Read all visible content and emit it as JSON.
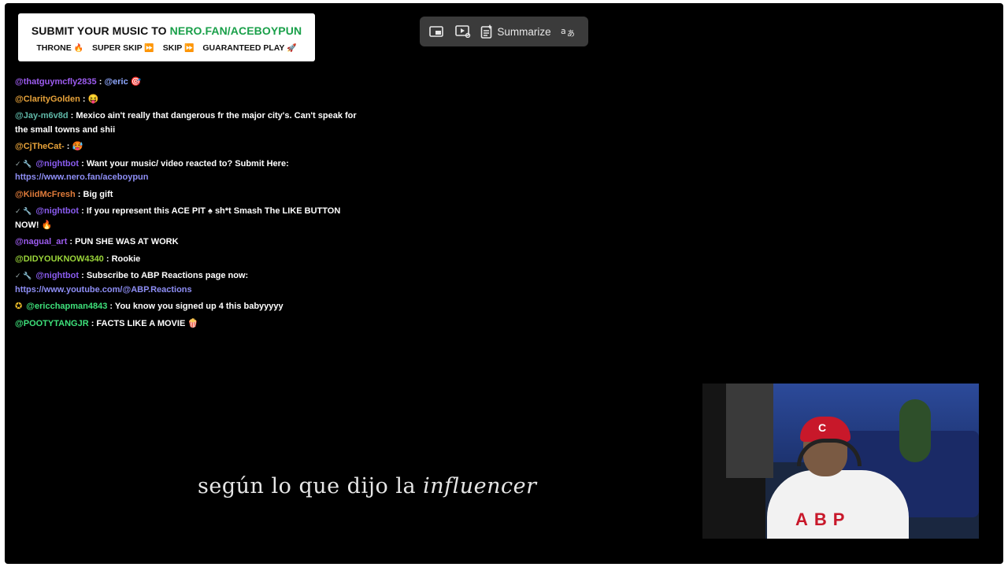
{
  "banner": {
    "line1_prefix": "SUBMIT YOUR MUSIC TO ",
    "line1_link": "NERO.FAN/ACEBOYPUN",
    "tiers": [
      {
        "label": "THRONE",
        "emoji": "🔥"
      },
      {
        "label": "SUPER SKIP",
        "emoji": "⏩"
      },
      {
        "label": "SKIP",
        "emoji": "⏩"
      },
      {
        "label": "GUARANTEED PLAY",
        "emoji": "🚀"
      }
    ]
  },
  "toolbar": {
    "summarize_label": "Summarize",
    "icons": [
      "picture-in-picture-icon",
      "video-cast-icon",
      "summarize-icon",
      "translate-icon"
    ]
  },
  "chat": {
    "messages": [
      {
        "badge": "",
        "user": "@thatguymcfly2835",
        "user_color": "#9d5cf0",
        "text": "",
        "mention": "@eric",
        "emoji": "🎯"
      },
      {
        "badge": "",
        "user": "@ClarityGolden",
        "user_color": "#e8a33a",
        "text": "",
        "emoji": "😝"
      },
      {
        "badge": "",
        "user": "@Jay-m6v8d",
        "user_color": "#5fb8a8",
        "text": "Mexico ain't really that dangerous fr the major city's. Can't speak for the small towns and shii"
      },
      {
        "badge": "",
        "user": "@CjTheCat-",
        "user_color": "#e8a33a",
        "text": "",
        "emoji": "🥵"
      },
      {
        "badge": "✓ 🔧",
        "user": "@nightbot",
        "user_color": "#8a5cf0",
        "text": "Want your music/ video reacted to? Submit Here:",
        "link": "https://www.nero.fan/aceboypun"
      },
      {
        "badge": "",
        "user": "@KiidMcFresh",
        "user_color": "#e07b3a",
        "text": "Big gift"
      },
      {
        "badge": "✓ 🔧",
        "user": "@nightbot",
        "user_color": "#8a5cf0",
        "text": "If you represent this ACE PIT ♠ sh*t Smash The LIKE BUTTON NOW! 🔥"
      },
      {
        "badge": "",
        "user": "@nagual_art",
        "user_color": "#9d5cf0",
        "text": "PUN SHE WAS AT WORK"
      },
      {
        "badge": "",
        "user": "@DIDYOUKNOW4340",
        "user_color": "#9bd63a",
        "text": "Rookie"
      },
      {
        "badge": "✓ 🔧",
        "user": "@nightbot",
        "user_color": "#8a5cf0",
        "text": "Subscribe to ABP Reactions page now:",
        "link": "https://www.youtube.com/@ABP.Reactions"
      },
      {
        "badge": "✪",
        "user": "@ericchapman4843",
        "user_color": "#3ee07a",
        "text": "You know you signed up 4 this babyyyyy"
      },
      {
        "badge": "",
        "user": "@POOTYTANGJR",
        "user_color": "#3ee07a",
        "text": "FACTS LIKE A MOVIE",
        "emoji": "🍿"
      }
    ]
  },
  "subtitle": {
    "normal": "según lo que dijo la ",
    "italic": "influencer"
  },
  "colors": {
    "background": "#000000",
    "link": "#8e8ef5",
    "banner_accent": "#1aa04a",
    "toolbar_bg": "#3b3b3b"
  }
}
